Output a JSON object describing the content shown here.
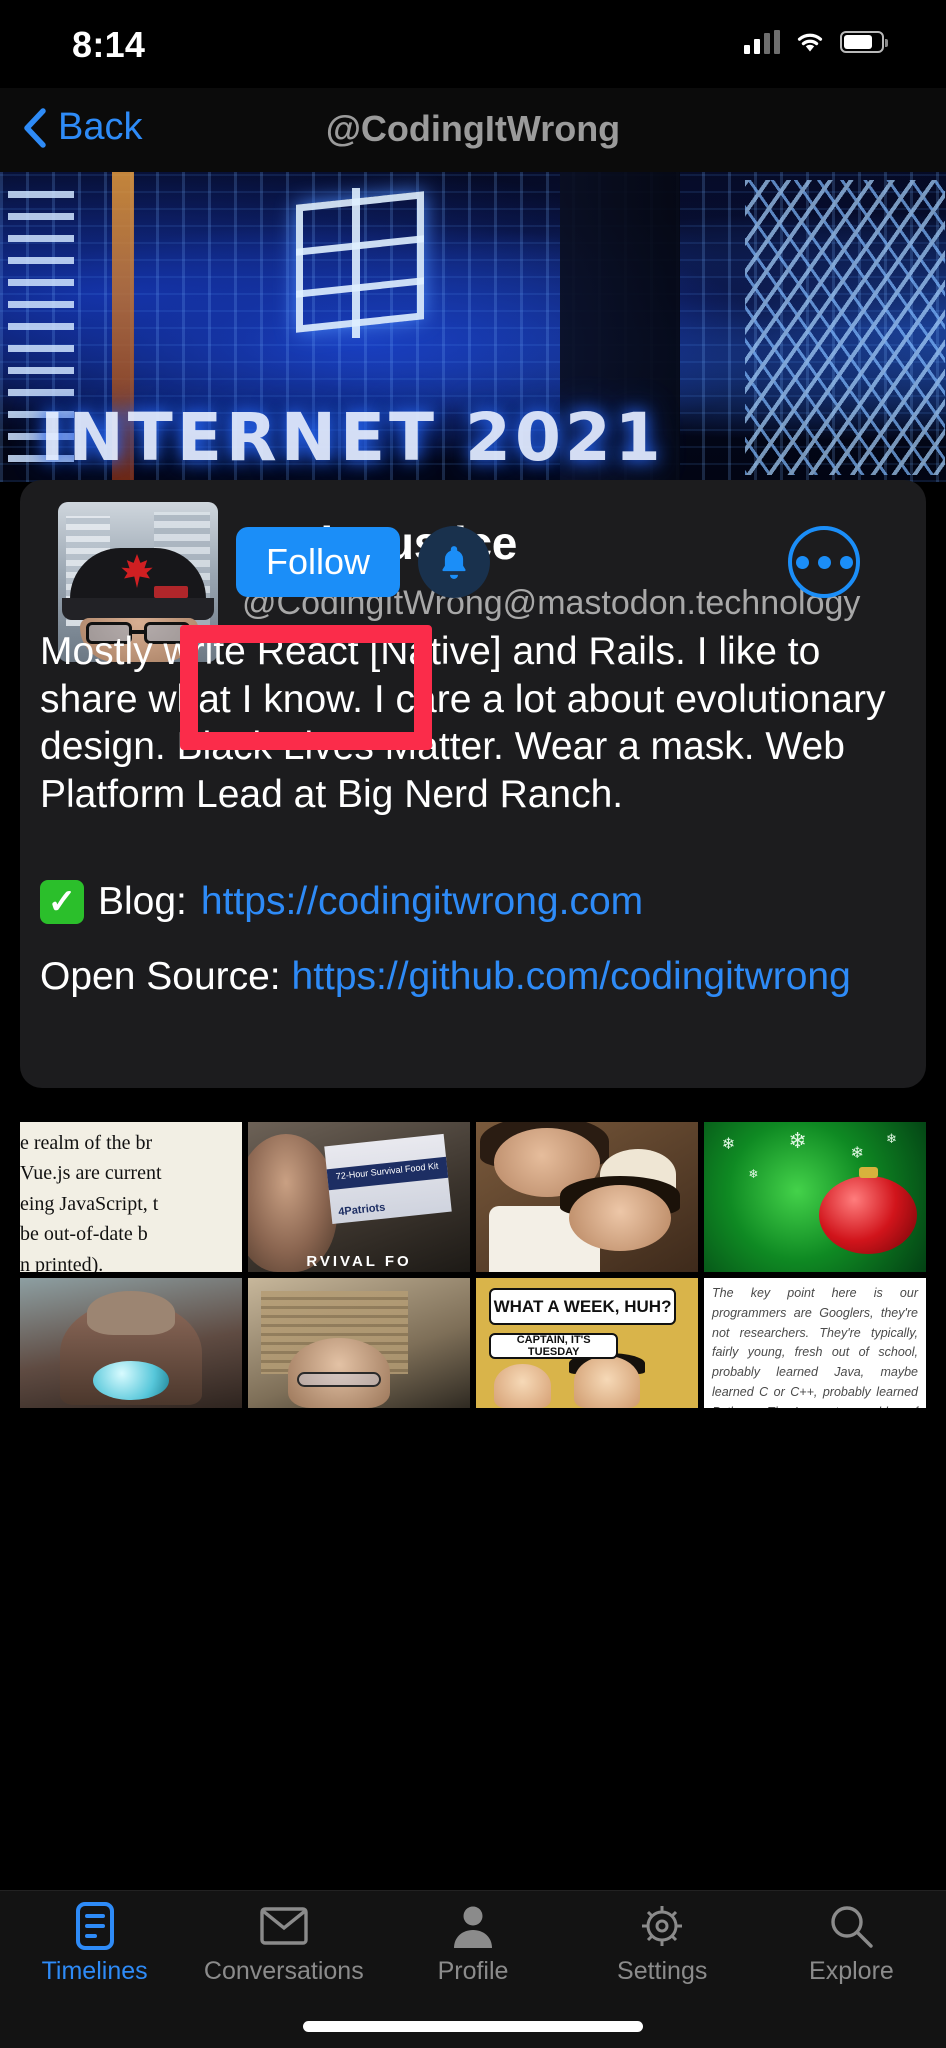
{
  "status_bar": {
    "time": "8:14",
    "cellular_icon": "cellular-signal-icon",
    "wifi_icon": "wifi-icon",
    "battery_icon": "battery-icon"
  },
  "nav": {
    "back_label": "Back",
    "back_icon": "chevron-left-icon",
    "title": "@CodingItWrong"
  },
  "banner": {
    "overlay_text": "INTERNET 2021",
    "alt": "blue circuit board cyberpunk header image"
  },
  "profile": {
    "display_name": "Josh Justice",
    "handle": "@CodingItWrong@mastodon.technology",
    "avatar_alt": "man wearing black cap with red maple leaf and glasses",
    "follow_label": "Follow",
    "notify_icon": "bell-icon",
    "more_icon": "ellipsis-circle-icon",
    "bio": "Mostly write React [Native] and Rails. I like to share what I know. I care a lot about evolutionary design. Black Lives Matter. Wear a mask. Web Platform Lead at Big Nerd Ranch.",
    "links": [
      {
        "emoji": "✓",
        "label": "Blog:",
        "url": "https://codingitwrong.com"
      },
      {
        "label": "Open Source:",
        "url": "https://github.com/codingitwrong"
      }
    ]
  },
  "highlight": {
    "color": "#fb2c4a",
    "target": "follow-and-notify-controls"
  },
  "media_grid": [
    {
      "type": "document",
      "text": "e realm of the br\nVue.js are current\neing JavaScript, t\nbe out-of-date b\nn printed)."
    },
    {
      "type": "photo",
      "caption": "RVIVAL FO",
      "label": "72-Hour Survival Food Kit",
      "brand": "4Patriots"
    },
    {
      "type": "photo",
      "alt": "smiling couple in period costume"
    },
    {
      "type": "photo",
      "alt": "green christmas background with red ornament"
    },
    {
      "type": "photo",
      "alt": "painting of hooded wizard with glowing orb"
    },
    {
      "type": "photo",
      "alt": "person with headphones in front of bookshelf"
    },
    {
      "type": "comic",
      "bubble1": "WHAT A WEEK, HUH?",
      "bubble2": "CAPTAIN, IT'S TUESDAY"
    },
    {
      "type": "quote",
      "text": "The key point here is our programmers are Googlers, they're not researchers. They're typically, fairly young, fresh out of school, probably learned Java, maybe learned C or C++, probably learned Python. They're not capable of understanding a brilliant language but we want to use them to build good"
    }
  ],
  "tab_bar": {
    "active_index": 0,
    "items": [
      {
        "label": "Timelines",
        "icon": "timelines-icon"
      },
      {
        "label": "Conversations",
        "icon": "envelope-icon"
      },
      {
        "label": "Profile",
        "icon": "person-icon"
      },
      {
        "label": "Settings",
        "icon": "gear-icon"
      },
      {
        "label": "Explore",
        "icon": "search-icon"
      }
    ]
  },
  "colors": {
    "accent": "#2e8bf7",
    "follow_button": "#1b8ef8",
    "card_bg": "#1c1c1e",
    "highlight": "#fb2c4a",
    "background": "#000000"
  }
}
